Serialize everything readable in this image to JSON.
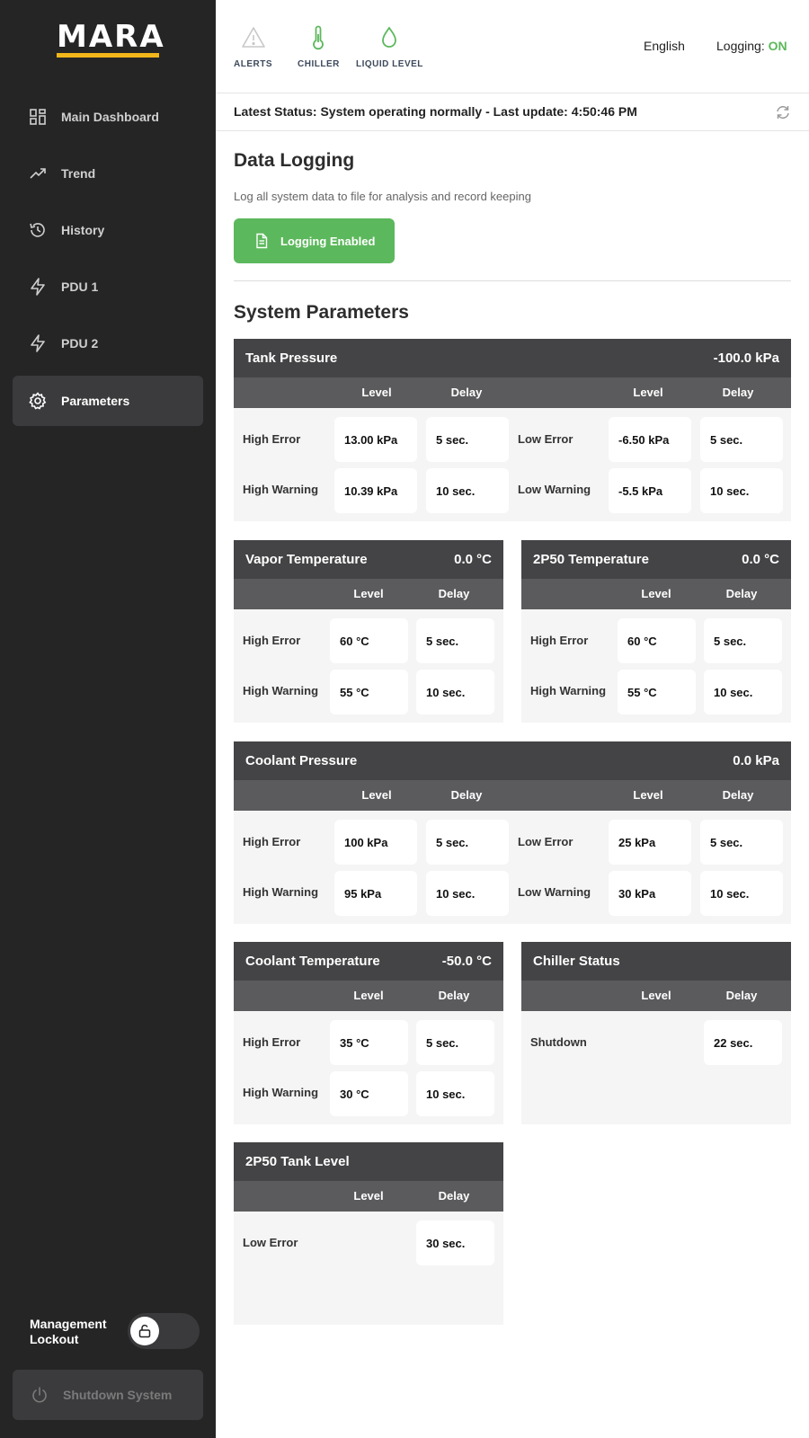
{
  "brand": {
    "logo": "MARA"
  },
  "sidebar": {
    "items": [
      {
        "label": "Main Dashboard",
        "icon": "dashboard-grid-icon"
      },
      {
        "label": "Trend",
        "icon": "trend-icon"
      },
      {
        "label": "History",
        "icon": "history-icon"
      },
      {
        "label": "PDU 1",
        "icon": "lightning-icon"
      },
      {
        "label": "PDU 2",
        "icon": "lightning-icon"
      },
      {
        "label": "Parameters",
        "icon": "gear-icon",
        "active": true
      }
    ],
    "lockout_label": "Management Lockout",
    "shutdown_label": "Shutdown System"
  },
  "topbar": {
    "alerts": "ALERTS",
    "chiller": "CHILLER",
    "liquid_level": "LIQUID LEVEL",
    "language": "English",
    "logging_label": "Logging:",
    "logging_value": "ON"
  },
  "status": {
    "text": "Latest Status: System operating normally - Last update: 4:50:46 PM"
  },
  "data_logging": {
    "title": "Data Logging",
    "description": "Log all system data to file for analysis and record keeping",
    "button_label": "Logging Enabled"
  },
  "system_parameters": {
    "title": "System Parameters",
    "col_level": "Level",
    "col_delay": "Delay",
    "tank_pressure": {
      "title": "Tank Pressure",
      "reading": "-100.0 kPa",
      "high_error": {
        "label": "High Error",
        "level": "13.00 kPa",
        "delay": "5 sec."
      },
      "high_warning": {
        "label": "High Warning",
        "level": "10.39 kPa",
        "delay": "10 sec."
      },
      "low_error": {
        "label": "Low Error",
        "level": "-6.50 kPa",
        "delay": "5 sec."
      },
      "low_warning": {
        "label": "Low Warning",
        "level": "-5.5 kPa",
        "delay": "10 sec."
      }
    },
    "vapor_temperature": {
      "title": "Vapor Temperature",
      "reading": "0.0 °C",
      "high_error": {
        "label": "High Error",
        "level": "60 °C",
        "delay": "5 sec."
      },
      "high_warning": {
        "label": "High Warning",
        "level": "55 °C",
        "delay": "10 sec."
      }
    },
    "p2p50_temperature": {
      "title": "2P50 Temperature",
      "reading": "0.0 °C",
      "high_error": {
        "label": "High Error",
        "level": "60 °C",
        "delay": "5 sec."
      },
      "high_warning": {
        "label": "High Warning",
        "level": "55 °C",
        "delay": "10 sec."
      }
    },
    "coolant_pressure": {
      "title": "Coolant Pressure",
      "reading": "0.0 kPa",
      "high_error": {
        "label": "High Error",
        "level": "100 kPa",
        "delay": "5 sec."
      },
      "high_warning": {
        "label": "High Warning",
        "level": "95 kPa",
        "delay": "10 sec."
      },
      "low_error": {
        "label": "Low Error",
        "level": "25 kPa",
        "delay": "5 sec."
      },
      "low_warning": {
        "label": "Low Warning",
        "level": "30 kPa",
        "delay": "10 sec."
      }
    },
    "coolant_temperature": {
      "title": "Coolant Temperature",
      "reading": "-50.0 °C",
      "high_error": {
        "label": "High Error",
        "level": "35 °C",
        "delay": "5 sec."
      },
      "high_warning": {
        "label": "High Warning",
        "level": "30 °C",
        "delay": "10 sec."
      }
    },
    "chiller_status": {
      "title": "Chiller Status",
      "shutdown": {
        "label": "Shutdown",
        "delay": "22 sec."
      }
    },
    "tank_level": {
      "title": "2P50 Tank Level",
      "low_error": {
        "label": "Low Error",
        "delay": "30 sec."
      }
    }
  },
  "colors": {
    "accent_green": "#5cb85c",
    "logo_yellow": "#f1b61a",
    "sidebar_bg": "#252526"
  }
}
